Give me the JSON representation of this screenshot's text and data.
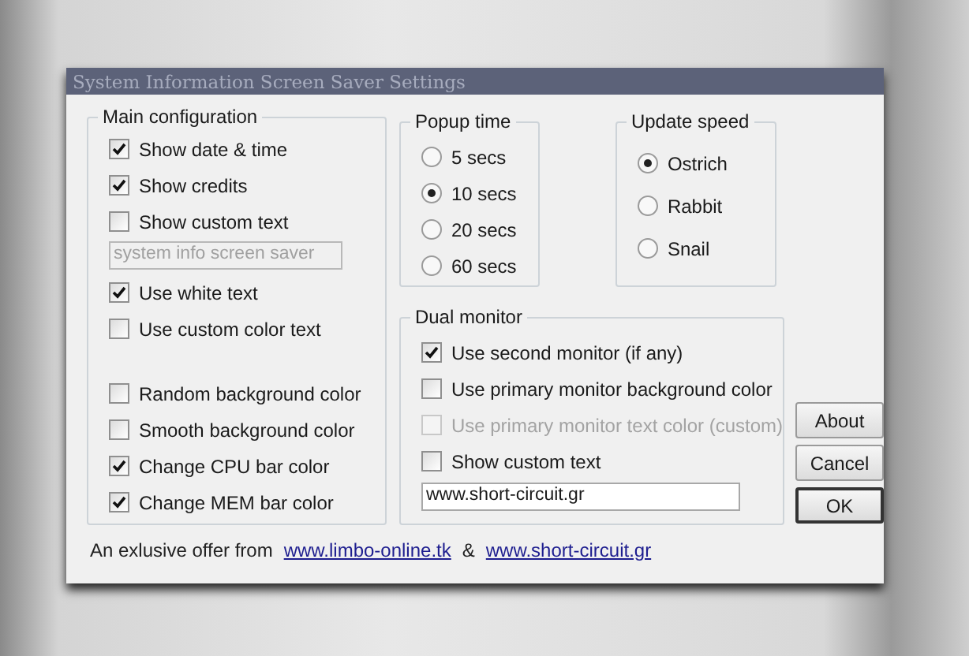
{
  "window": {
    "title": "System Information Screen Saver Settings"
  },
  "main_configuration": {
    "title": "Main configuration",
    "options": [
      {
        "kind": "checkbox",
        "label": "Show date & time",
        "checked": true
      },
      {
        "kind": "checkbox",
        "label": "Show credits",
        "checked": true
      },
      {
        "kind": "checkbox",
        "label": "Show custom text",
        "checked": false
      },
      {
        "kind": "field",
        "value": "system info screen saver",
        "disabled": true
      },
      {
        "kind": "checkbox",
        "label": "Use white text",
        "checked": true
      },
      {
        "kind": "checkbox",
        "label": "Use custom color text",
        "checked": false
      }
    ],
    "color_options": [
      {
        "label": "Random background color",
        "checked": false
      },
      {
        "label": "Smooth background color",
        "checked": false
      },
      {
        "label": "Change CPU bar color",
        "checked": true
      },
      {
        "label": "Change MEM bar color",
        "checked": true
      }
    ]
  },
  "popup_time": {
    "title": "Popup time",
    "options": [
      {
        "label": "5 secs",
        "selected": false
      },
      {
        "label": "10 secs",
        "selected": true
      },
      {
        "label": "20 secs",
        "selected": false
      },
      {
        "label": "60 secs",
        "selected": false
      }
    ]
  },
  "update_speed": {
    "title": "Update speed",
    "options": [
      {
        "label": "Ostrich",
        "selected": true
      },
      {
        "label": "Rabbit",
        "selected": false
      },
      {
        "label": "Snail",
        "selected": false
      }
    ]
  },
  "dual_monitor": {
    "title": "Dual monitor",
    "options": [
      {
        "kind": "checkbox",
        "label": "Use second monitor (if any)",
        "checked": true,
        "disabled": false
      },
      {
        "kind": "checkbox",
        "label": "Use primary monitor background color",
        "checked": false,
        "disabled": false
      },
      {
        "kind": "checkbox",
        "label": "Use primary monitor text color (custom)",
        "checked": false,
        "disabled": true
      },
      {
        "kind": "checkbox",
        "label": "Show custom text",
        "checked": false,
        "disabled": false
      },
      {
        "kind": "field",
        "value": "www.short-circuit.gr",
        "disabled": false
      }
    ]
  },
  "buttons": [
    {
      "label": "About",
      "default": false
    },
    {
      "label": "Cancel",
      "default": false
    },
    {
      "label": "OK",
      "default": true
    }
  ],
  "footer": [
    {
      "kind": "text",
      "text": "An exlusive offer from"
    },
    {
      "kind": "link",
      "text": "www.limbo-online.tk"
    },
    {
      "kind": "text",
      "text": "&"
    },
    {
      "kind": "link",
      "text": "www.short-circuit.gr"
    }
  ]
}
